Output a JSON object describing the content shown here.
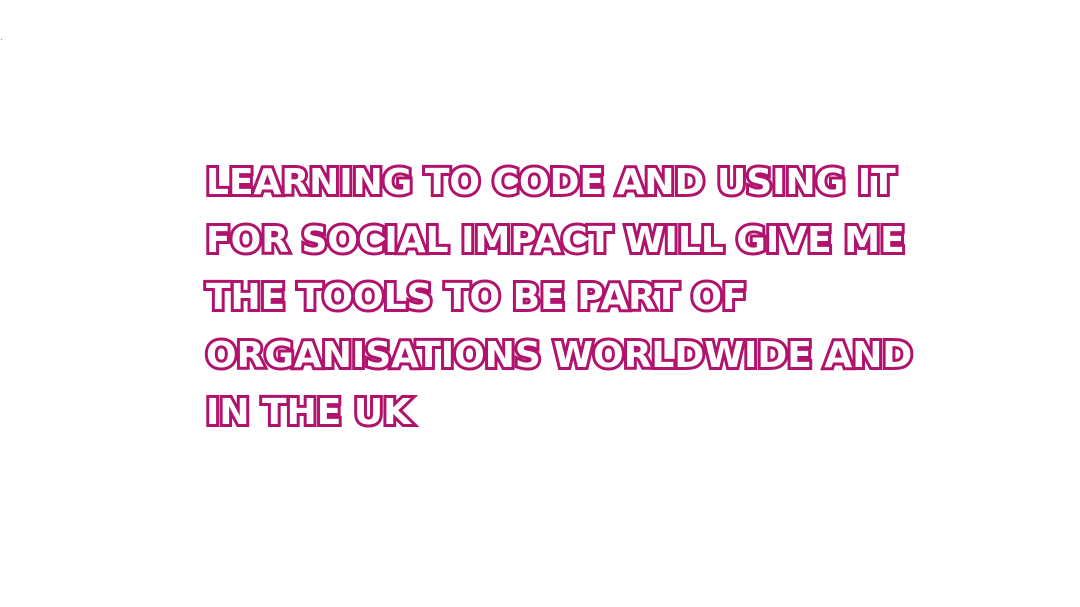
{
  "quote": {
    "lines": [
      "LEARNING TO CODE AND USING IT",
      "FOR SOCIAL IMPACT WILL GIVE ME",
      "THE TOOLS TO BE PART OF",
      "ORGANISATIONS WORLDWIDE AND",
      "IN THE UK"
    ]
  },
  "colors": {
    "text_outline": "#b0126c",
    "text_fill": "#ffffff",
    "background": "#ffffff"
  }
}
